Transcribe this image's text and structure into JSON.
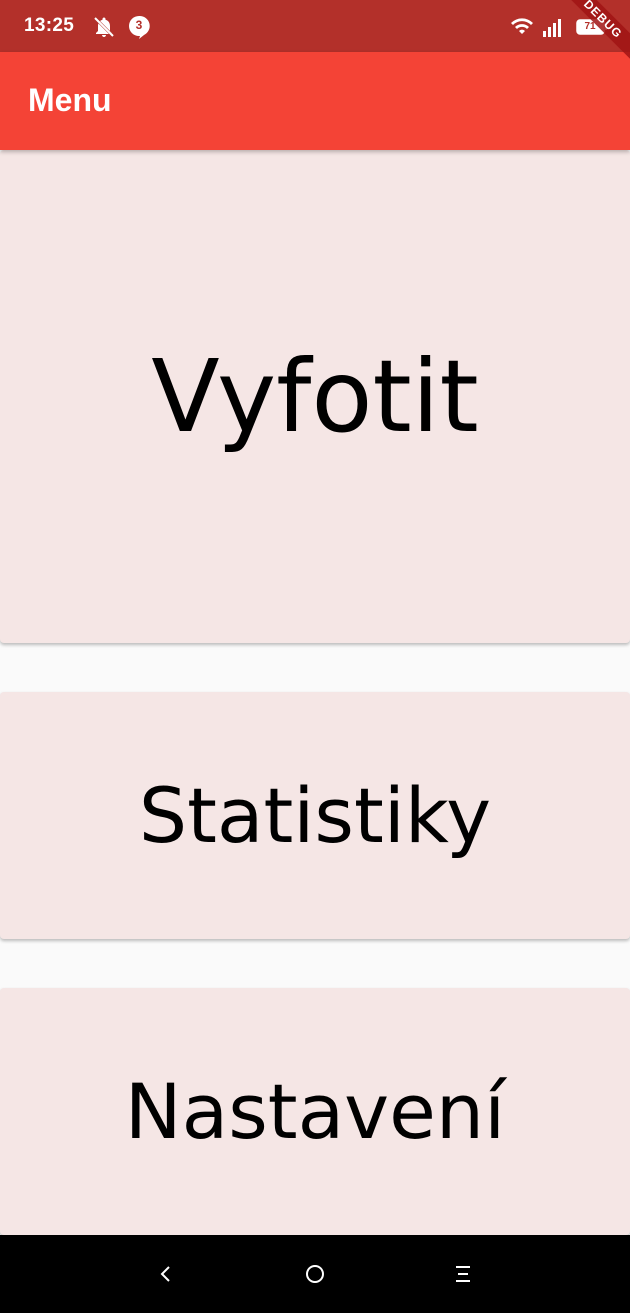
{
  "status_bar": {
    "time": "13:25",
    "notification_count": "3",
    "battery_level": "71",
    "icons": [
      "bell-off-icon",
      "message-icon",
      "wifi-icon",
      "signal-icon",
      "battery-icon"
    ]
  },
  "debug_banner": "DEBUG",
  "app_bar": {
    "title": "Menu"
  },
  "menu": {
    "photo_label": "Vyfotit",
    "stats_label": "Statistiky",
    "settings_label": "Nastavení"
  },
  "nav_bar": {
    "icons": [
      "back-icon",
      "home-icon",
      "menu-icon"
    ]
  },
  "colors": {
    "status_bar": "#b3302a",
    "app_bar": "#f44336",
    "card_background": "#f5e6e5",
    "page_background": "#fafafa",
    "nav_bar": "#000000"
  }
}
